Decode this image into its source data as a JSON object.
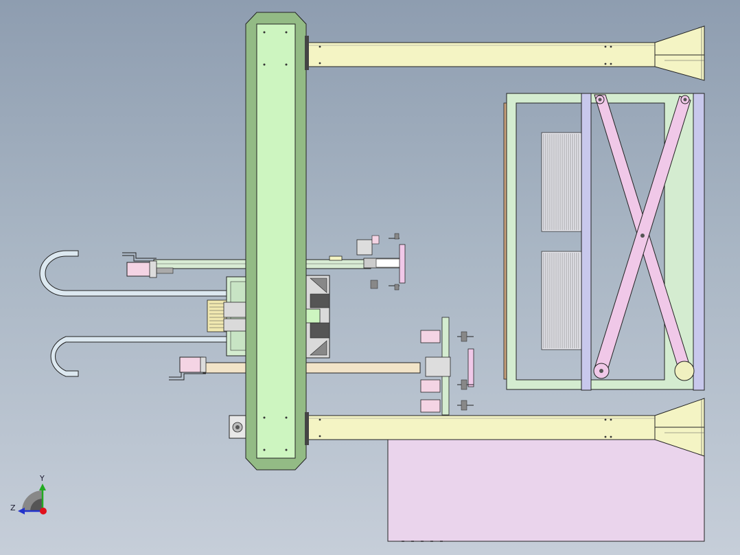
{
  "viewport": {
    "background_top": "#8e9db0",
    "background_bottom": "#c6ced9"
  },
  "colors": {
    "column_green": "#cdf5c0",
    "column_dark": "#93bb85",
    "beam_yellow": "#f4f4c4",
    "frame_green": "#d4ecd0",
    "scissor_pink": "#f0c8e8",
    "post_lavender": "#c8c8ec",
    "base_pink": "#ead4ec",
    "hook_blue": "#dce8f0",
    "slide_wood": "#f2e4c8",
    "motor_pink": "#f4d4e4"
  },
  "triad": {
    "x_axis_icon": "x-axis-arrow-icon",
    "y_label": "Y",
    "z_label": "Z"
  }
}
